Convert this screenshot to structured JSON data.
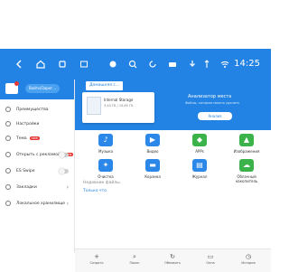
{
  "statusbar": {
    "clock": "14:25"
  },
  "drawer": {
    "header_button": "Войти/Зарег...",
    "items": [
      {
        "label": "Преимущества"
      },
      {
        "label": "Настройки"
      },
      {
        "label": "Тема",
        "badge": "new"
      },
      {
        "label": "Открыть с рекламой",
        "badge": "new"
      },
      {
        "label": "ES Swipe"
      },
      {
        "label": "Закладки"
      },
      {
        "label": "Локальное хранилище"
      }
    ]
  },
  "main": {
    "breadcrumb": "Домашняя с...",
    "storage_card": {
      "title": "Internal Storage",
      "subtitle": "3,44 ГБ / 15,65 ГБ"
    },
    "analyzer": {
      "title": "Анализатор места",
      "subtitle": "Файлы, которые можно удалить",
      "button": "Анализ"
    },
    "categories": [
      {
        "label": "Музыка",
        "icon": "music-icon",
        "color": "#2b87e8"
      },
      {
        "label": "Видео",
        "icon": "video-icon",
        "color": "#2b87e8"
      },
      {
        "label": "APPs",
        "icon": "android-icon",
        "color": "#3cb34a"
      },
      {
        "label": "Изображения",
        "icon": "image-icon",
        "color": "#3cb34a"
      },
      {
        "label": "Очистка",
        "icon": "broom-icon",
        "color": "#2b87e8"
      },
      {
        "label": "Корзина",
        "icon": "trash-icon",
        "color": "#2b87e8"
      },
      {
        "label": "Журнал",
        "icon": "journal-icon",
        "color": "#2b87e8"
      },
      {
        "label": "Облачный накопитель",
        "icon": "cloud-icon",
        "color": "#3cb34a"
      }
    ],
    "recent_header": "Недавние файлы",
    "recent_item": "Только что"
  },
  "bottombar": {
    "items": [
      {
        "label": "Создать",
        "icon": "plus-icon"
      },
      {
        "label": "Поиск",
        "icon": "search-icon"
      },
      {
        "label": "Обновить",
        "icon": "refresh-icon"
      },
      {
        "label": "Окна",
        "icon": "window-icon"
      },
      {
        "label": "История",
        "icon": "history-icon"
      }
    ]
  },
  "colors": {
    "primary": "#2283e4",
    "accent_green": "#3cb34a",
    "badge_red": "#e53935"
  }
}
